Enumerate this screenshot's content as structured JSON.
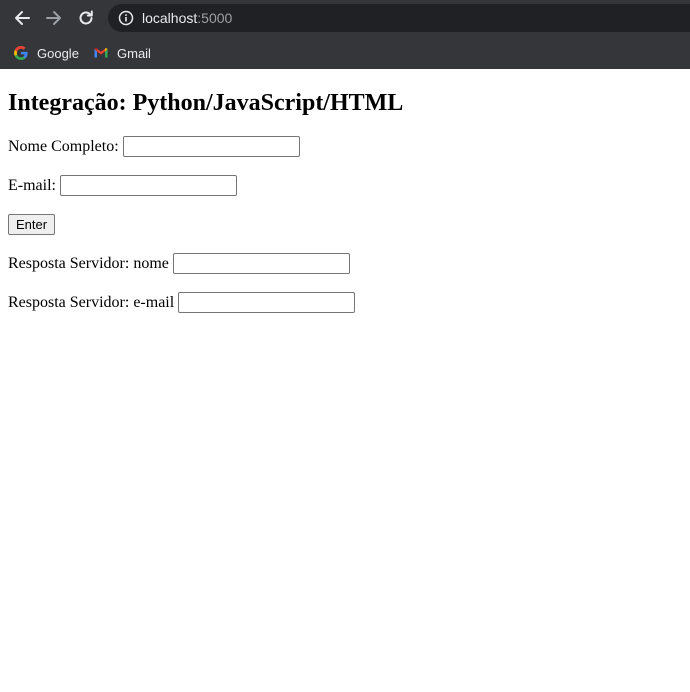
{
  "browser": {
    "url_host": "localhost",
    "url_port": ":5000",
    "bookmarks": [
      {
        "label": "Google",
        "icon": "google-icon"
      },
      {
        "label": "Gmail",
        "icon": "gmail-icon"
      }
    ],
    "colors": {
      "toolbar": "#35363a",
      "omnibox": "#202124"
    }
  },
  "page": {
    "title": "Integração: Python/JavaScript/HTML",
    "form": {
      "nome_label": "Nome Completo:",
      "nome_value": "",
      "email_label": "E-mail:",
      "email_value": "",
      "enter_label": "Enter",
      "resp_nome_label": "Resposta Servidor: nome",
      "resp_nome_value": "",
      "resp_email_label": "Resposta Servidor: e-mail",
      "resp_email_value": ""
    }
  }
}
